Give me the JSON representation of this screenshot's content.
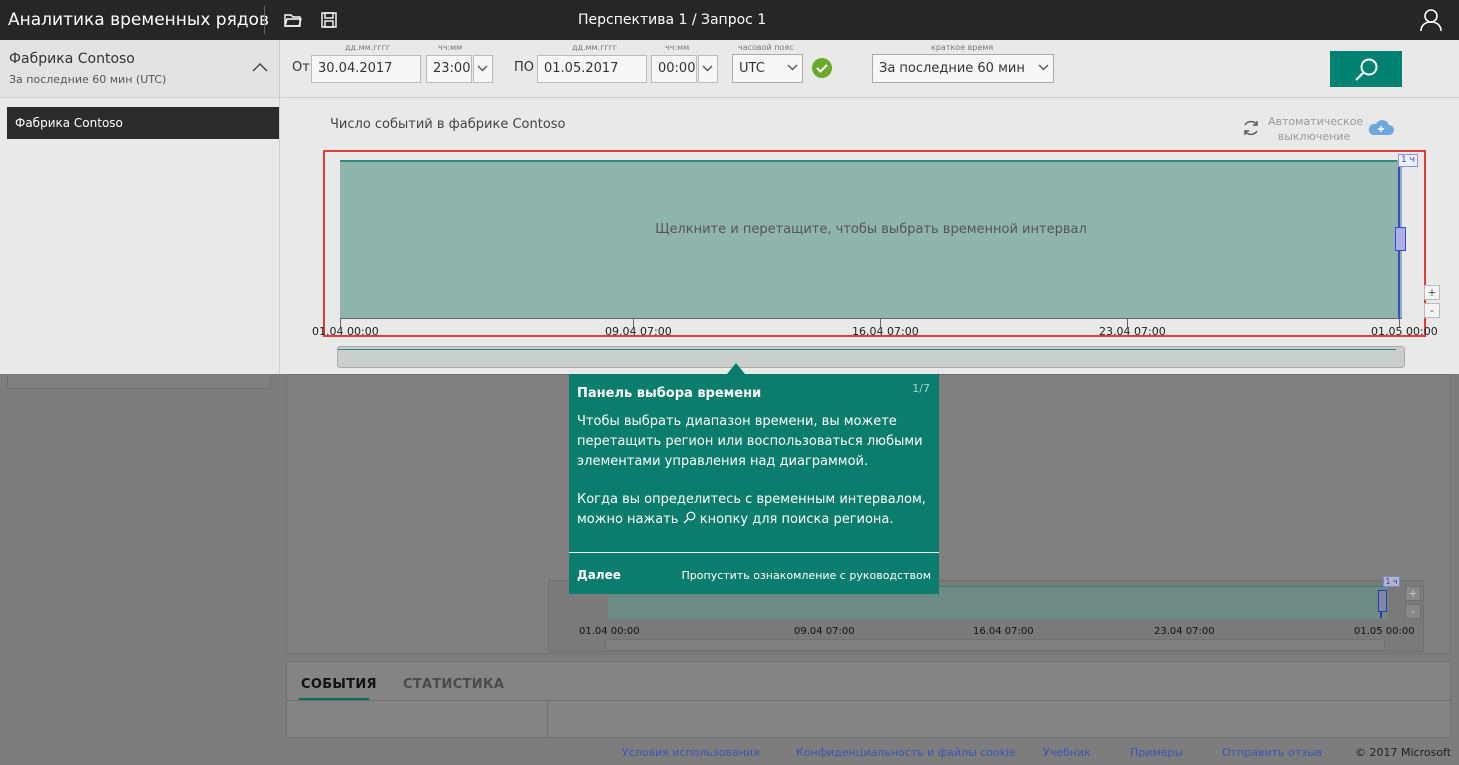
{
  "topbar": {
    "app_title": "Аналитика временных рядов",
    "query_title": "Перспектива 1 / Запрос 1"
  },
  "environment": {
    "name": "Фабрика Contoso",
    "range": "За последние 60 мин (UTC)",
    "items": [
      "Фабрика Contoso"
    ]
  },
  "time_controls": {
    "from_label": "От",
    "to_label": "ПО",
    "date_format": "дд.мм.гггг",
    "time_format": "чч:мм",
    "timezone_caption": "часовой пояс",
    "quicktime_caption": "краткое время",
    "from_date": "30.04.2017",
    "from_time": "23:00",
    "to_date": "01.05.2017",
    "to_time": "00:00",
    "timezone": "UTC",
    "quick_time": "За последние 60 мин"
  },
  "chart": {
    "title": "Число событий в фабрике Contoso",
    "auto_off": "Автоматическое выключение",
    "brush_hint": "Щелкните и перетащите, чтобы выбрать временной интервал",
    "interval_badge": "1 ч",
    "zoom_in": "+",
    "zoom_out": "-",
    "x_ticks": [
      "01.04 00:00",
      "09.04 07:00",
      "16.04 07:00",
      "23.04 07:00",
      "01.05 00:00"
    ]
  },
  "chart_data": {
    "type": "area",
    "x": [
      "01.04 00:00",
      "09.04 07:00",
      "16.04 07:00",
      "23.04 07:00",
      "01.05 00:00"
    ],
    "values": [
      1,
      1,
      1,
      1,
      1
    ],
    "title": "Число событий в фабрике Contoso",
    "xlabel": "",
    "ylabel": "",
    "grid": false,
    "color": "#8fb4ab",
    "line_color": "#2e8a78"
  },
  "tour": {
    "title": "Панель выбора времени",
    "counter": "1/7",
    "paragraph1": "Чтобы выбрать диапазон времени, вы можете перетащить регион или воспользоваться любыми элементами управления над диаграммой.",
    "paragraph2_a": "Когда вы определитесь с временным интервалом, можно нажать",
    "paragraph2_b": "кнопку для поиска региона.",
    "next": "Далее",
    "skip": "Пропустить ознакомление с руководством",
    "color": "#0a7d6c"
  },
  "background": {
    "mini_ticks": [
      "01.04 00:00",
      "09.04 07:00",
      "16.04 07:00",
      "23.04 07:00",
      "01.05 00:00"
    ],
    "mini_badge": "1 ч",
    "tabs": [
      "СОБЫТИЯ",
      "СТАТИСТИКА"
    ]
  },
  "footer": {
    "links": [
      "Условия использования",
      "Конфиденциальность и файлы cookie",
      "Учебник",
      "Примеры",
      "Отправить отзыв"
    ],
    "copyright": "© 2017 Microsoft"
  }
}
